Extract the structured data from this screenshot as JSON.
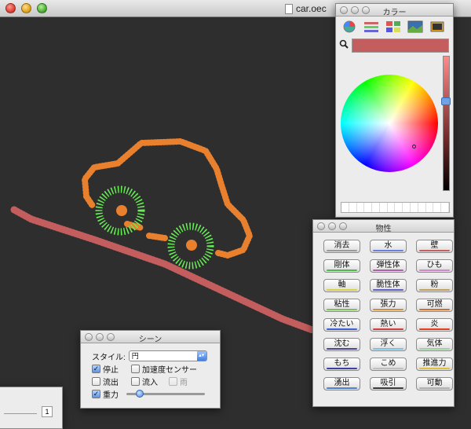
{
  "window": {
    "title": "car.oec"
  },
  "color_palette": {
    "title": "カラー",
    "tools": [
      "color-wheel-icon",
      "color-sliders-icon",
      "color-palettes-icon",
      "image-palettes-icon",
      "crayons-icon"
    ],
    "current_color": "#c45e5e",
    "mode": "color-wheel"
  },
  "physics_palette": {
    "title": "物性",
    "buttons": [
      {
        "label": "消去",
        "accent": "#9a9a9a"
      },
      {
        "label": "水",
        "accent": "#6b7fe0"
      },
      {
        "label": "壁",
        "accent": "#c46060"
      },
      {
        "label": "剛体",
        "accent": "#4fb84f"
      },
      {
        "label": "弾性体",
        "accent": "#b060b0"
      },
      {
        "label": "ひも",
        "accent": "#d08acc"
      },
      {
        "label": "軸",
        "accent": "#d8d24a"
      },
      {
        "label": "脆性体",
        "accent": "#6060c0"
      },
      {
        "label": "粉",
        "accent": "#c0a060"
      },
      {
        "label": "粘性",
        "accent": "#80c060"
      },
      {
        "label": "張力",
        "accent": "#d09040"
      },
      {
        "label": "可燃",
        "accent": "#d07030"
      },
      {
        "label": "冷たい",
        "accent": "#4060d0"
      },
      {
        "label": "熱い",
        "accent": "#d04040"
      },
      {
        "label": "炎",
        "accent": "#e04020"
      },
      {
        "label": "沈む",
        "accent": "#4a4a8a"
      },
      {
        "label": "浮く",
        "accent": "#80c0e0"
      },
      {
        "label": "気体",
        "accent": "#a0d0a0"
      },
      {
        "label": "もち",
        "accent": "#4040a0"
      },
      {
        "label": "こめ",
        "accent": "#c0c0c0"
      },
      {
        "label": "推進力",
        "accent": "#e0c040"
      },
      {
        "label": "湧出",
        "accent": "#5080d0"
      },
      {
        "label": "吸引",
        "accent": "#3a3a3a"
      },
      {
        "label": "可動",
        "accent": "#b0b0b0"
      }
    ]
  },
  "scene_palette": {
    "title": "シーン",
    "style_label": "スタイル:",
    "style_value": "円",
    "options": {
      "pause": {
        "label": "停止",
        "checked": true
      },
      "accel_sensor": {
        "label": "加速度センサー",
        "checked": false
      },
      "outflow": {
        "label": "流出",
        "checked": false
      },
      "inflow": {
        "label": "流入",
        "checked": false
      },
      "rain": {
        "label": "雨",
        "checked": false,
        "enabled": false
      },
      "gravity": {
        "label": "重力",
        "checked": true
      }
    },
    "gravity_level": 0.17
  },
  "partial_window": {
    "value": "1"
  }
}
